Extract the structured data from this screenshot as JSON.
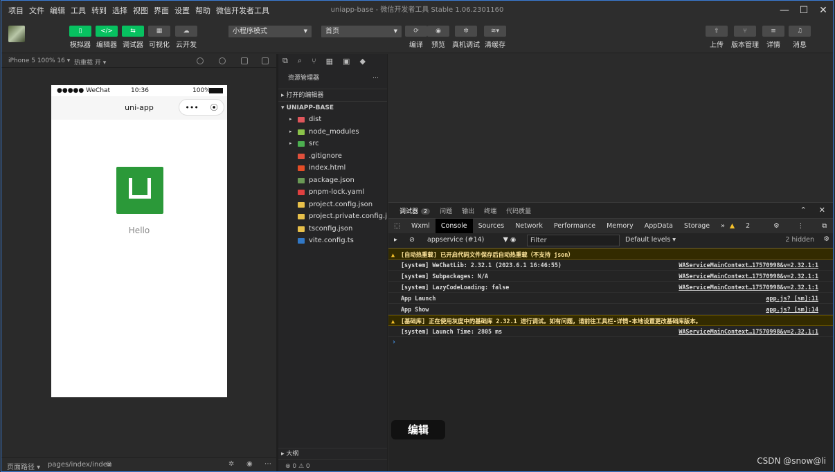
{
  "menubar": {
    "items": [
      "项目",
      "文件",
      "编辑",
      "工具",
      "转到",
      "选择",
      "视图",
      "界面",
      "设置",
      "帮助",
      "微信开发者工具"
    ],
    "title": "uniapp-base - 微信开发者工具 Stable 1.06.2301160"
  },
  "toolbar": {
    "left_buttons": [
      "模拟器",
      "编辑器",
      "调试器",
      "可视化",
      "云开发"
    ],
    "mode_select": "小程序模式",
    "page_select": "首页",
    "mid_buttons": [
      "编译",
      "预览",
      "真机调试",
      "清缓存"
    ],
    "right_buttons": [
      "上传",
      "版本管理",
      "详情",
      "消息"
    ]
  },
  "simbar": {
    "device": "iPhone 5 100% 16 ▾",
    "hotreload": "热重载 开 ▾"
  },
  "phone": {
    "carrier": "●●●●● WeChat",
    "time": "10:36",
    "battery": "100%",
    "nav_title": "uni-app",
    "hello": "Hello"
  },
  "pathbar": {
    "label": "页面路径 ▾",
    "path": "pages/index/index"
  },
  "explorer": {
    "title": "资源管理器",
    "open_editors": "打开的编辑器",
    "project": "UNIAPP-BASE",
    "items": [
      {
        "name": "dist",
        "folder": true,
        "color": "#e0565b"
      },
      {
        "name": "node_modules",
        "folder": true,
        "color": "#8bc34a"
      },
      {
        "name": "src",
        "folder": true,
        "color": "#4caf50"
      },
      {
        "name": ".gitignore",
        "folder": false,
        "color": "#e0503c"
      },
      {
        "name": "index.html",
        "folder": false,
        "color": "#e44d26"
      },
      {
        "name": "package.json",
        "folder": false,
        "color": "#6a9955"
      },
      {
        "name": "pnpm-lock.yaml",
        "folder": false,
        "color": "#e04040"
      },
      {
        "name": "project.config.json",
        "folder": false,
        "color": "#e8c04a"
      },
      {
        "name": "project.private.config.js...",
        "folder": false,
        "color": "#e8c04a"
      },
      {
        "name": "tsconfig.json",
        "folder": false,
        "color": "#e8c04a"
      },
      {
        "name": "vite.config.ts",
        "folder": false,
        "color": "#3178c6"
      }
    ],
    "outline": "大纲",
    "status": "⊗ 0 ⚠ 0"
  },
  "debugger": {
    "tabs": [
      "调试器",
      "问题",
      "输出",
      "终端",
      "代码质量"
    ],
    "badge": "2",
    "devtools_tabs": [
      "Wxml",
      "Console",
      "Sources",
      "Network",
      "Performance",
      "Memory",
      "AppData",
      "Storage"
    ],
    "warn_count": "2",
    "context": "appservice (#14)",
    "filter_placeholder": "Filter",
    "levels": "Default levels ▾",
    "hidden": "2 hidden",
    "logs": [
      {
        "type": "warn",
        "text": "[自动热重载] 已开启代码文件保存后自动热重载（不支持 json）",
        "src": ""
      },
      {
        "type": "log",
        "text": "[system] WeChatLib: 2.32.1 (2023.6.1 16:46:55)",
        "src": "WAServiceMainContext…17570998&v=2.32.1:1"
      },
      {
        "type": "log",
        "text": "[system] Subpackages: N/A",
        "src": "WAServiceMainContext…17570998&v=2.32.1:1"
      },
      {
        "type": "log",
        "text": "[system] LazyCodeLoading: false",
        "src": "WAServiceMainContext…17570998&v=2.32.1:1"
      },
      {
        "type": "log",
        "text": "App Launch",
        "src": "app.js? [sm]:11"
      },
      {
        "type": "log",
        "text": "App Show",
        "src": "app.js? [sm]:14"
      },
      {
        "type": "warn",
        "text": "[基础库] 正在使用灰度中的基础库 2.32.1 进行调试。如有问题，请前往工具栏-详情-本地设置更改基础库版本。",
        "src": ""
      },
      {
        "type": "log",
        "text": "[system] Launch Time: 2805 ms",
        "src": "WAServiceMainContext…17570998&v=2.32.1:1"
      }
    ],
    "edit_button": "编辑"
  },
  "watermark": "CSDN @snow@li"
}
